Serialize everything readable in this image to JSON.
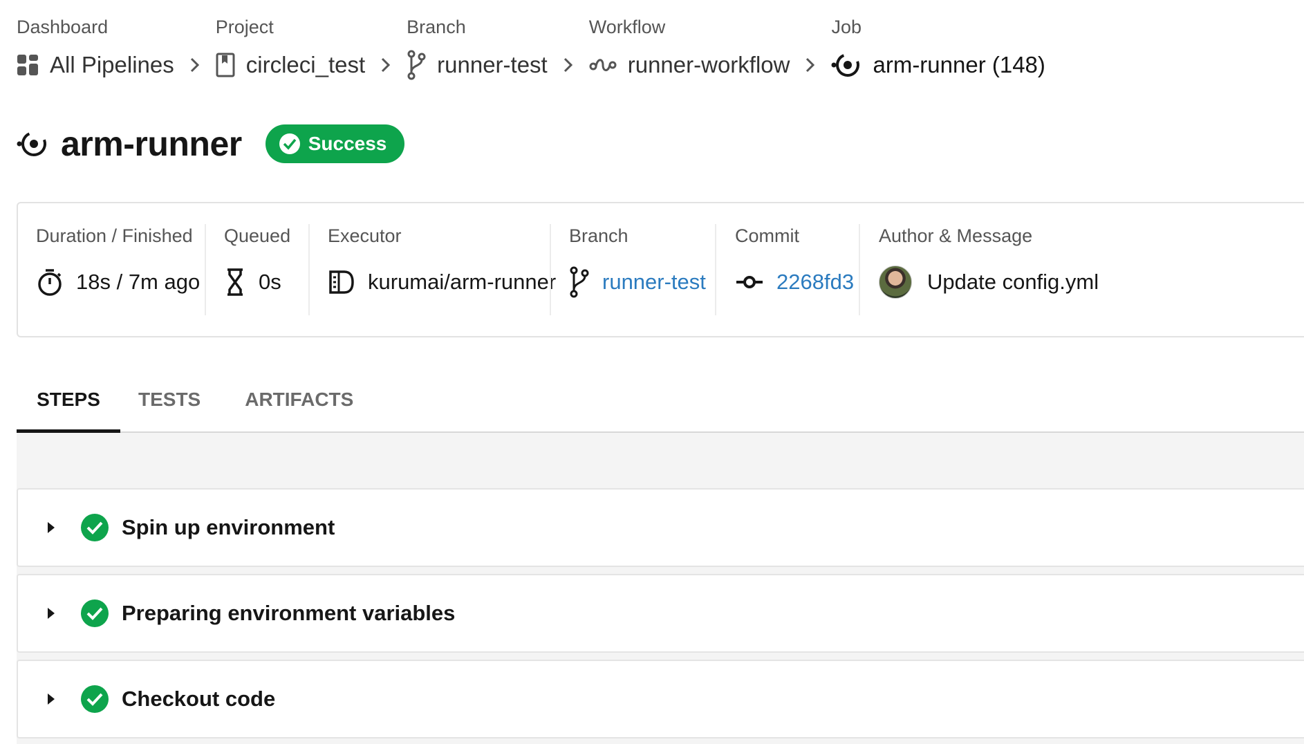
{
  "breadcrumbs": [
    {
      "label": "Dashboard",
      "value": "All Pipelines",
      "icon": "dashboard-grid-icon"
    },
    {
      "label": "Project",
      "value": "circleci_test",
      "icon": "project-book-icon"
    },
    {
      "label": "Branch",
      "value": "runner-test",
      "icon": "branch-icon"
    },
    {
      "label": "Workflow",
      "value": "runner-workflow",
      "icon": "workflow-icon"
    },
    {
      "label": "Job",
      "value": "arm-runner (148)",
      "icon": "job-icon"
    }
  ],
  "header": {
    "title": "arm-runner",
    "status": "Success",
    "status_color": "#0ea44c"
  },
  "summary": {
    "duration": {
      "label": "Duration / Finished",
      "value": "18s / 7m ago",
      "icon": "stopwatch-icon"
    },
    "queued": {
      "label": "Queued",
      "value": "0s",
      "icon": "hourglass-icon"
    },
    "executor": {
      "label": "Executor",
      "value": "kurumai/arm-runner",
      "icon": "executor-icon"
    },
    "branch": {
      "label": "Branch",
      "value": "runner-test",
      "icon": "branch-icon"
    },
    "commit": {
      "label": "Commit",
      "value": "2268fd3",
      "icon": "commit-icon"
    },
    "author": {
      "label": "Author & Message",
      "value": "Update config.yml",
      "icon": "avatar"
    }
  },
  "tabs": [
    {
      "label": "STEPS",
      "active": true
    },
    {
      "label": "TESTS",
      "active": false
    },
    {
      "label": "ARTIFACTS",
      "active": false
    }
  ],
  "steps": [
    {
      "name": "Spin up environment",
      "status": "success"
    },
    {
      "name": "Preparing environment variables",
      "status": "success"
    },
    {
      "name": "Checkout code",
      "status": "success"
    }
  ],
  "colors": {
    "success": "#0ea44c",
    "link": "#2b7bbf",
    "text": "#161616",
    "muted": "#555555"
  }
}
